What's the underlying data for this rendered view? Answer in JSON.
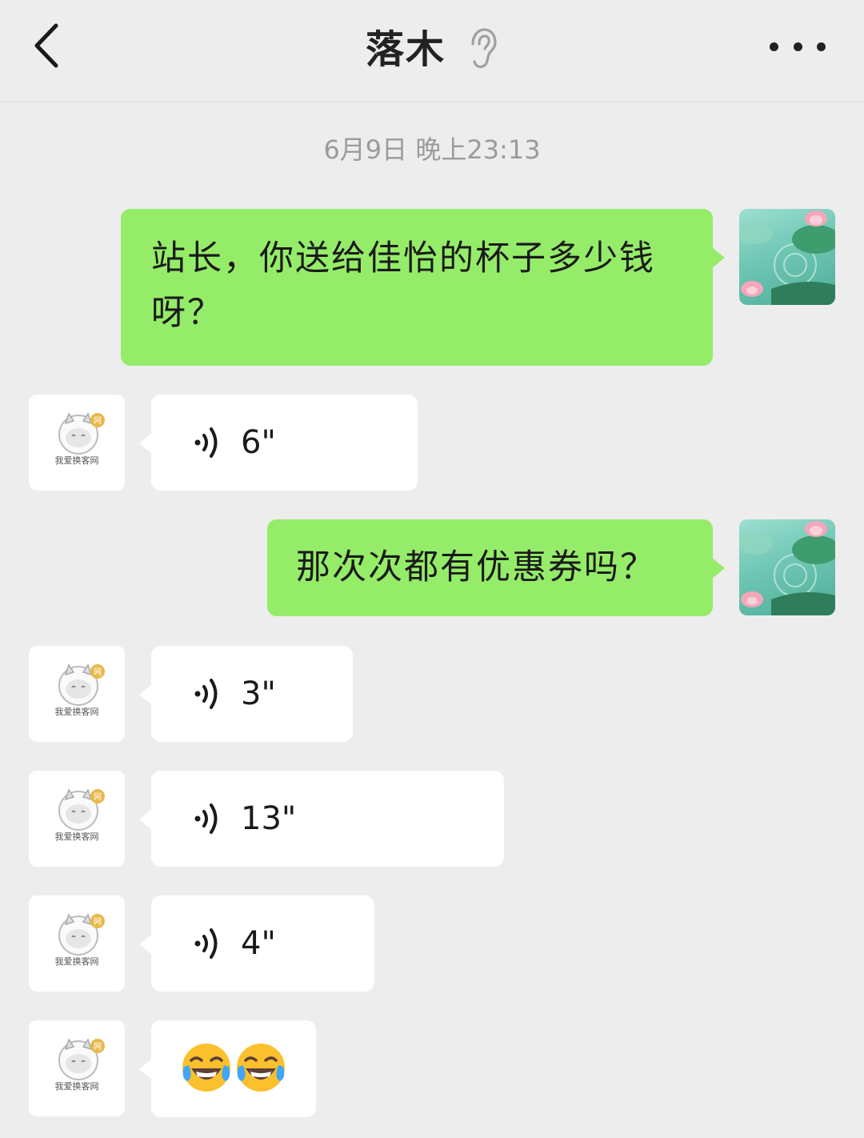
{
  "header": {
    "title": "落木",
    "back_icon": "chevron-left-icon",
    "mode_icon": "ear-icon",
    "more_icon": "more-dots-icon"
  },
  "timestamp": "6月9日 晚上23:13",
  "messages": [
    {
      "from": "me",
      "type": "text",
      "text": "站长，你送给佳怡的杯子多少钱呀？"
    },
    {
      "from": "other",
      "type": "voice",
      "duration": "6\""
    },
    {
      "from": "me",
      "type": "text",
      "text": "那次次都有优惠券吗？"
    },
    {
      "from": "other",
      "type": "voice",
      "duration": "3\""
    },
    {
      "from": "other",
      "type": "voice",
      "duration": "13\""
    },
    {
      "from": "other",
      "type": "voice",
      "duration": "4\""
    },
    {
      "from": "other",
      "type": "emoji",
      "emoji": "😂😂"
    }
  ],
  "avatars": {
    "other_logo_text": "我爱换客网",
    "other_badge": "网"
  },
  "colors": {
    "background": "#ededed",
    "sent_bubble": "#95ec69",
    "received_bubble": "#ffffff",
    "timestamp": "#9b9b9b"
  }
}
